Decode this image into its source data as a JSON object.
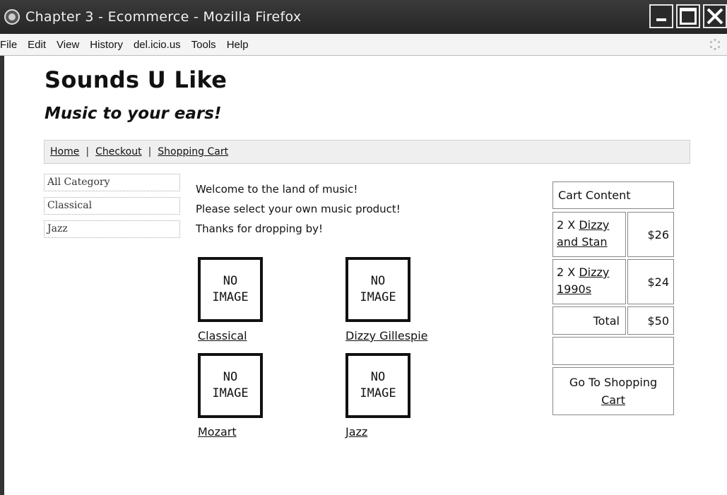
{
  "window": {
    "title": "Chapter 3 - Ecommerce - Mozilla Firefox"
  },
  "menu": [
    "File",
    "Edit",
    "View",
    "History",
    "del.icio.us",
    "Tools",
    "Help"
  ],
  "site": {
    "title": "Sounds U Like",
    "tagline": "Music to your ears!"
  },
  "nav": {
    "links": [
      "Home",
      "Checkout",
      "Shopping Cart"
    ],
    "separator": "|"
  },
  "categories": [
    "All Category",
    "Classical",
    "Jazz"
  ],
  "welcome": {
    "lines": [
      "Welcome to the land of music!",
      "Please select your own music product!",
      "Thanks for dropping by!"
    ]
  },
  "products": [
    {
      "name": "Classical",
      "image_text_1": "NO",
      "image_text_2": "IMAGE"
    },
    {
      "name": "Dizzy Gillespie",
      "image_text_1": "NO",
      "image_text_2": "IMAGE"
    },
    {
      "name": "Mozart",
      "image_text_1": "NO",
      "image_text_2": "IMAGE"
    },
    {
      "name": "Jazz",
      "image_text_1": "NO",
      "image_text_2": "IMAGE"
    }
  ],
  "cart": {
    "header": "Cart Content",
    "items": [
      {
        "qty": "2 X",
        "name": "Dizzy and Stan",
        "price": "$26"
      },
      {
        "qty": "2 X",
        "name": "Dizzy 1990s",
        "price": "$24"
      }
    ],
    "total_label": "Total",
    "total_price": "$50",
    "go_prefix": "Go To Shopping",
    "go_link": "Cart"
  },
  "icons": {
    "app": "firefox-icon",
    "minimize": "minimize-icon",
    "maximize": "maximize-icon",
    "close": "close-icon",
    "throbber": "throbber-icon"
  }
}
